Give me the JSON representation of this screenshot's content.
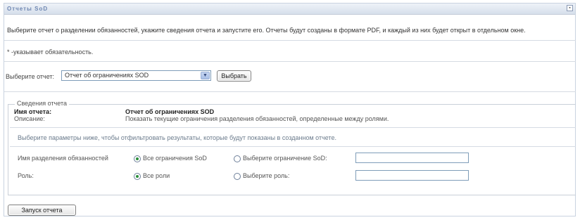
{
  "panel": {
    "title": "Отчеты SoD",
    "collapse_glyph": "▪"
  },
  "intro": {
    "text": "Выберите отчет о разделении обязанностей, укажите сведения отчета и запустите его. Отчеты будут созданы в формате PDF, и каждый из них будет открыт в отдельном окне.",
    "required_note": "* -указывает обязательность."
  },
  "report_select": {
    "label": "Выберите отчет:",
    "selected_value": "Отчет об ограничениях SOD",
    "arrow_icon": "chevron-down-icon",
    "select_button": "Выбрать"
  },
  "details": {
    "legend": "Сведения отчета",
    "name_label": "Имя отчета:",
    "name_value": "Отчет об ограничениях SOD",
    "description_label": "Описание:",
    "description_value": "Показать текущие ограничения разделения обязанностей, определенные между ролями.",
    "filter_hint": "Выберите параметры ниже, чтобы отфильтровать результаты, которые будут показаны в созданном отчете.",
    "rows": [
      {
        "label": "Имя разделения обязанностей",
        "option_all": "Все ограничения SoD",
        "option_choose": "Выберите ограничение SoD:",
        "selected": "all",
        "input_value": ""
      },
      {
        "label": "Роль:",
        "option_all": "Все роли",
        "option_choose": "Выберите роль:",
        "selected": "all",
        "input_value": ""
      }
    ]
  },
  "run_button": "Запуск отчета"
}
